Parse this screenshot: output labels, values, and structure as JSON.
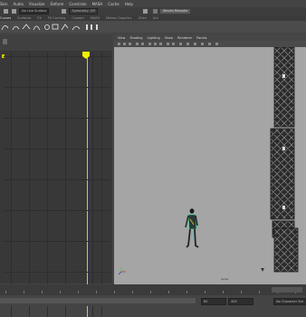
{
  "menubar": {
    "items": [
      "Skin",
      "Audio",
      "Visualize",
      "Deform",
      "Constrain",
      "MASH",
      "Cache",
      "Help"
    ]
  },
  "statusline": {
    "object_field": "No Live Surface",
    "symmetry": "Symmetry: Off",
    "sign_in": "Steven Beaudia"
  },
  "shelf": {
    "tabs": [
      "Curves",
      "Surfaces",
      "FX",
      "FX Caching",
      "Custom",
      "MASH",
      "Motion Graphics",
      "XGen",
      "Arn"
    ],
    "active_tab": "Curves"
  },
  "viewport": {
    "menu": [
      "View",
      "Shading",
      "Lighting",
      "Show",
      "Renderer",
      "Panels"
    ],
    "camera_label": "persp"
  },
  "timeline": {
    "range_start": "80",
    "range_end": "400",
    "character_set": "No Character Set"
  },
  "colors": {
    "playhead": "#e4e400",
    "viewport_bg": "#a5a5a5"
  }
}
